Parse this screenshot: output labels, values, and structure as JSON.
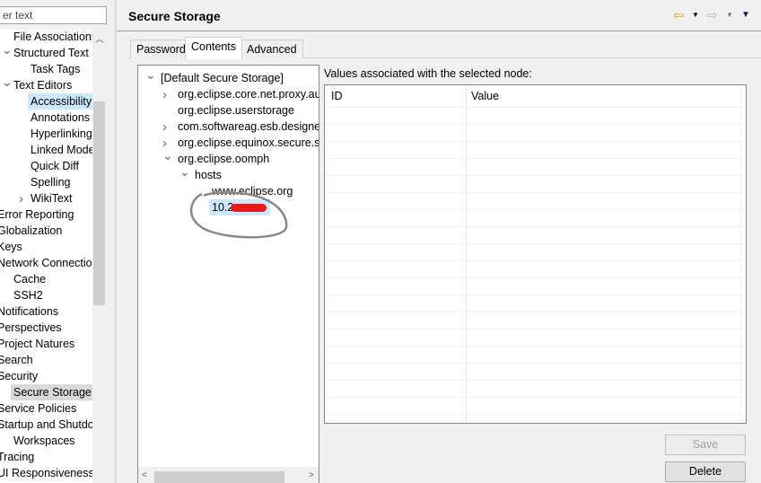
{
  "filter": {
    "value": "er text"
  },
  "nav": [
    {
      "label": "File Associations",
      "indent": 1,
      "chev": ""
    },
    {
      "label": "Structured Text E",
      "indent": 1,
      "chev": "down"
    },
    {
      "label": "Task Tags",
      "indent": 2,
      "chev": ""
    },
    {
      "label": "Text Editors",
      "indent": 1,
      "chev": "down"
    },
    {
      "label": "Accessibility",
      "indent": 2,
      "chev": "",
      "selected": true
    },
    {
      "label": "Annotations",
      "indent": 2,
      "chev": ""
    },
    {
      "label": "Hyperlinking",
      "indent": 2,
      "chev": ""
    },
    {
      "label": "Linked Mode",
      "indent": 2,
      "chev": ""
    },
    {
      "label": "Quick Diff",
      "indent": 2,
      "chev": ""
    },
    {
      "label": "Spelling",
      "indent": 2,
      "chev": ""
    },
    {
      "label": "WikiText",
      "indent": 2,
      "chev": "right"
    },
    {
      "label": "Error Reporting",
      "indent": 0,
      "chev": ""
    },
    {
      "label": "Globalization",
      "indent": 0,
      "chev": ""
    },
    {
      "label": "Keys",
      "indent": 0,
      "chev": ""
    },
    {
      "label": "Network Connection",
      "indent": 0,
      "chev": ""
    },
    {
      "label": "Cache",
      "indent": 1,
      "chev": ""
    },
    {
      "label": "SSH2",
      "indent": 1,
      "chev": ""
    },
    {
      "label": "Notifications",
      "indent": 0,
      "chev": ""
    },
    {
      "label": "Perspectives",
      "indent": 0,
      "chev": ""
    },
    {
      "label": "Project Natures",
      "indent": 0,
      "chev": ""
    },
    {
      "label": "Search",
      "indent": 0,
      "chev": ""
    },
    {
      "label": "Security",
      "indent": 0,
      "chev": ""
    },
    {
      "label": "Secure Storage",
      "indent": 1,
      "chev": "",
      "current": true
    },
    {
      "label": "Service Policies",
      "indent": 0,
      "chev": ""
    },
    {
      "label": "Startup and Shutdown",
      "indent": 0,
      "chev": ""
    },
    {
      "label": "Workspaces",
      "indent": 1,
      "chev": ""
    },
    {
      "label": "Tracing",
      "indent": 0,
      "chev": ""
    },
    {
      "label": "UI Responsiveness M",
      "indent": 0,
      "chev": ""
    }
  ],
  "page": {
    "title": "Secure Storage"
  },
  "toolbar": {
    "back": "back-icon",
    "forward": "forward-icon",
    "menu": "view-menu-icon"
  },
  "tabs": [
    "Password",
    "Contents",
    "Advanced"
  ],
  "active_tab": 1,
  "tree": [
    {
      "label": "[Default Secure Storage]",
      "level": 0,
      "chev": "down"
    },
    {
      "label": "org.eclipse.core.net.proxy.auth",
      "level": 1,
      "chev": "right"
    },
    {
      "label": "org.eclipse.userstorage",
      "level": 1,
      "chev": ""
    },
    {
      "label": "com.softwareag.esb.designer_",
      "level": 1,
      "chev": "right"
    },
    {
      "label": "org.eclipse.equinox.secure.storage",
      "level": 1,
      "chev": "right"
    },
    {
      "label": "org.eclipse.oomph",
      "level": 1,
      "chev": "down"
    },
    {
      "label": "hosts",
      "level": 2,
      "chev": "down"
    },
    {
      "label": "www.eclipse.org",
      "level": 3,
      "chev": ""
    },
    {
      "label": "10.2",
      "level": 3,
      "chev": "",
      "selected": true,
      "redacted": true
    }
  ],
  "values_label": "Values associated with the selected node:",
  "columns": [
    "ID",
    "Value"
  ],
  "buttons": {
    "save": "Save",
    "delete": "Delete"
  }
}
